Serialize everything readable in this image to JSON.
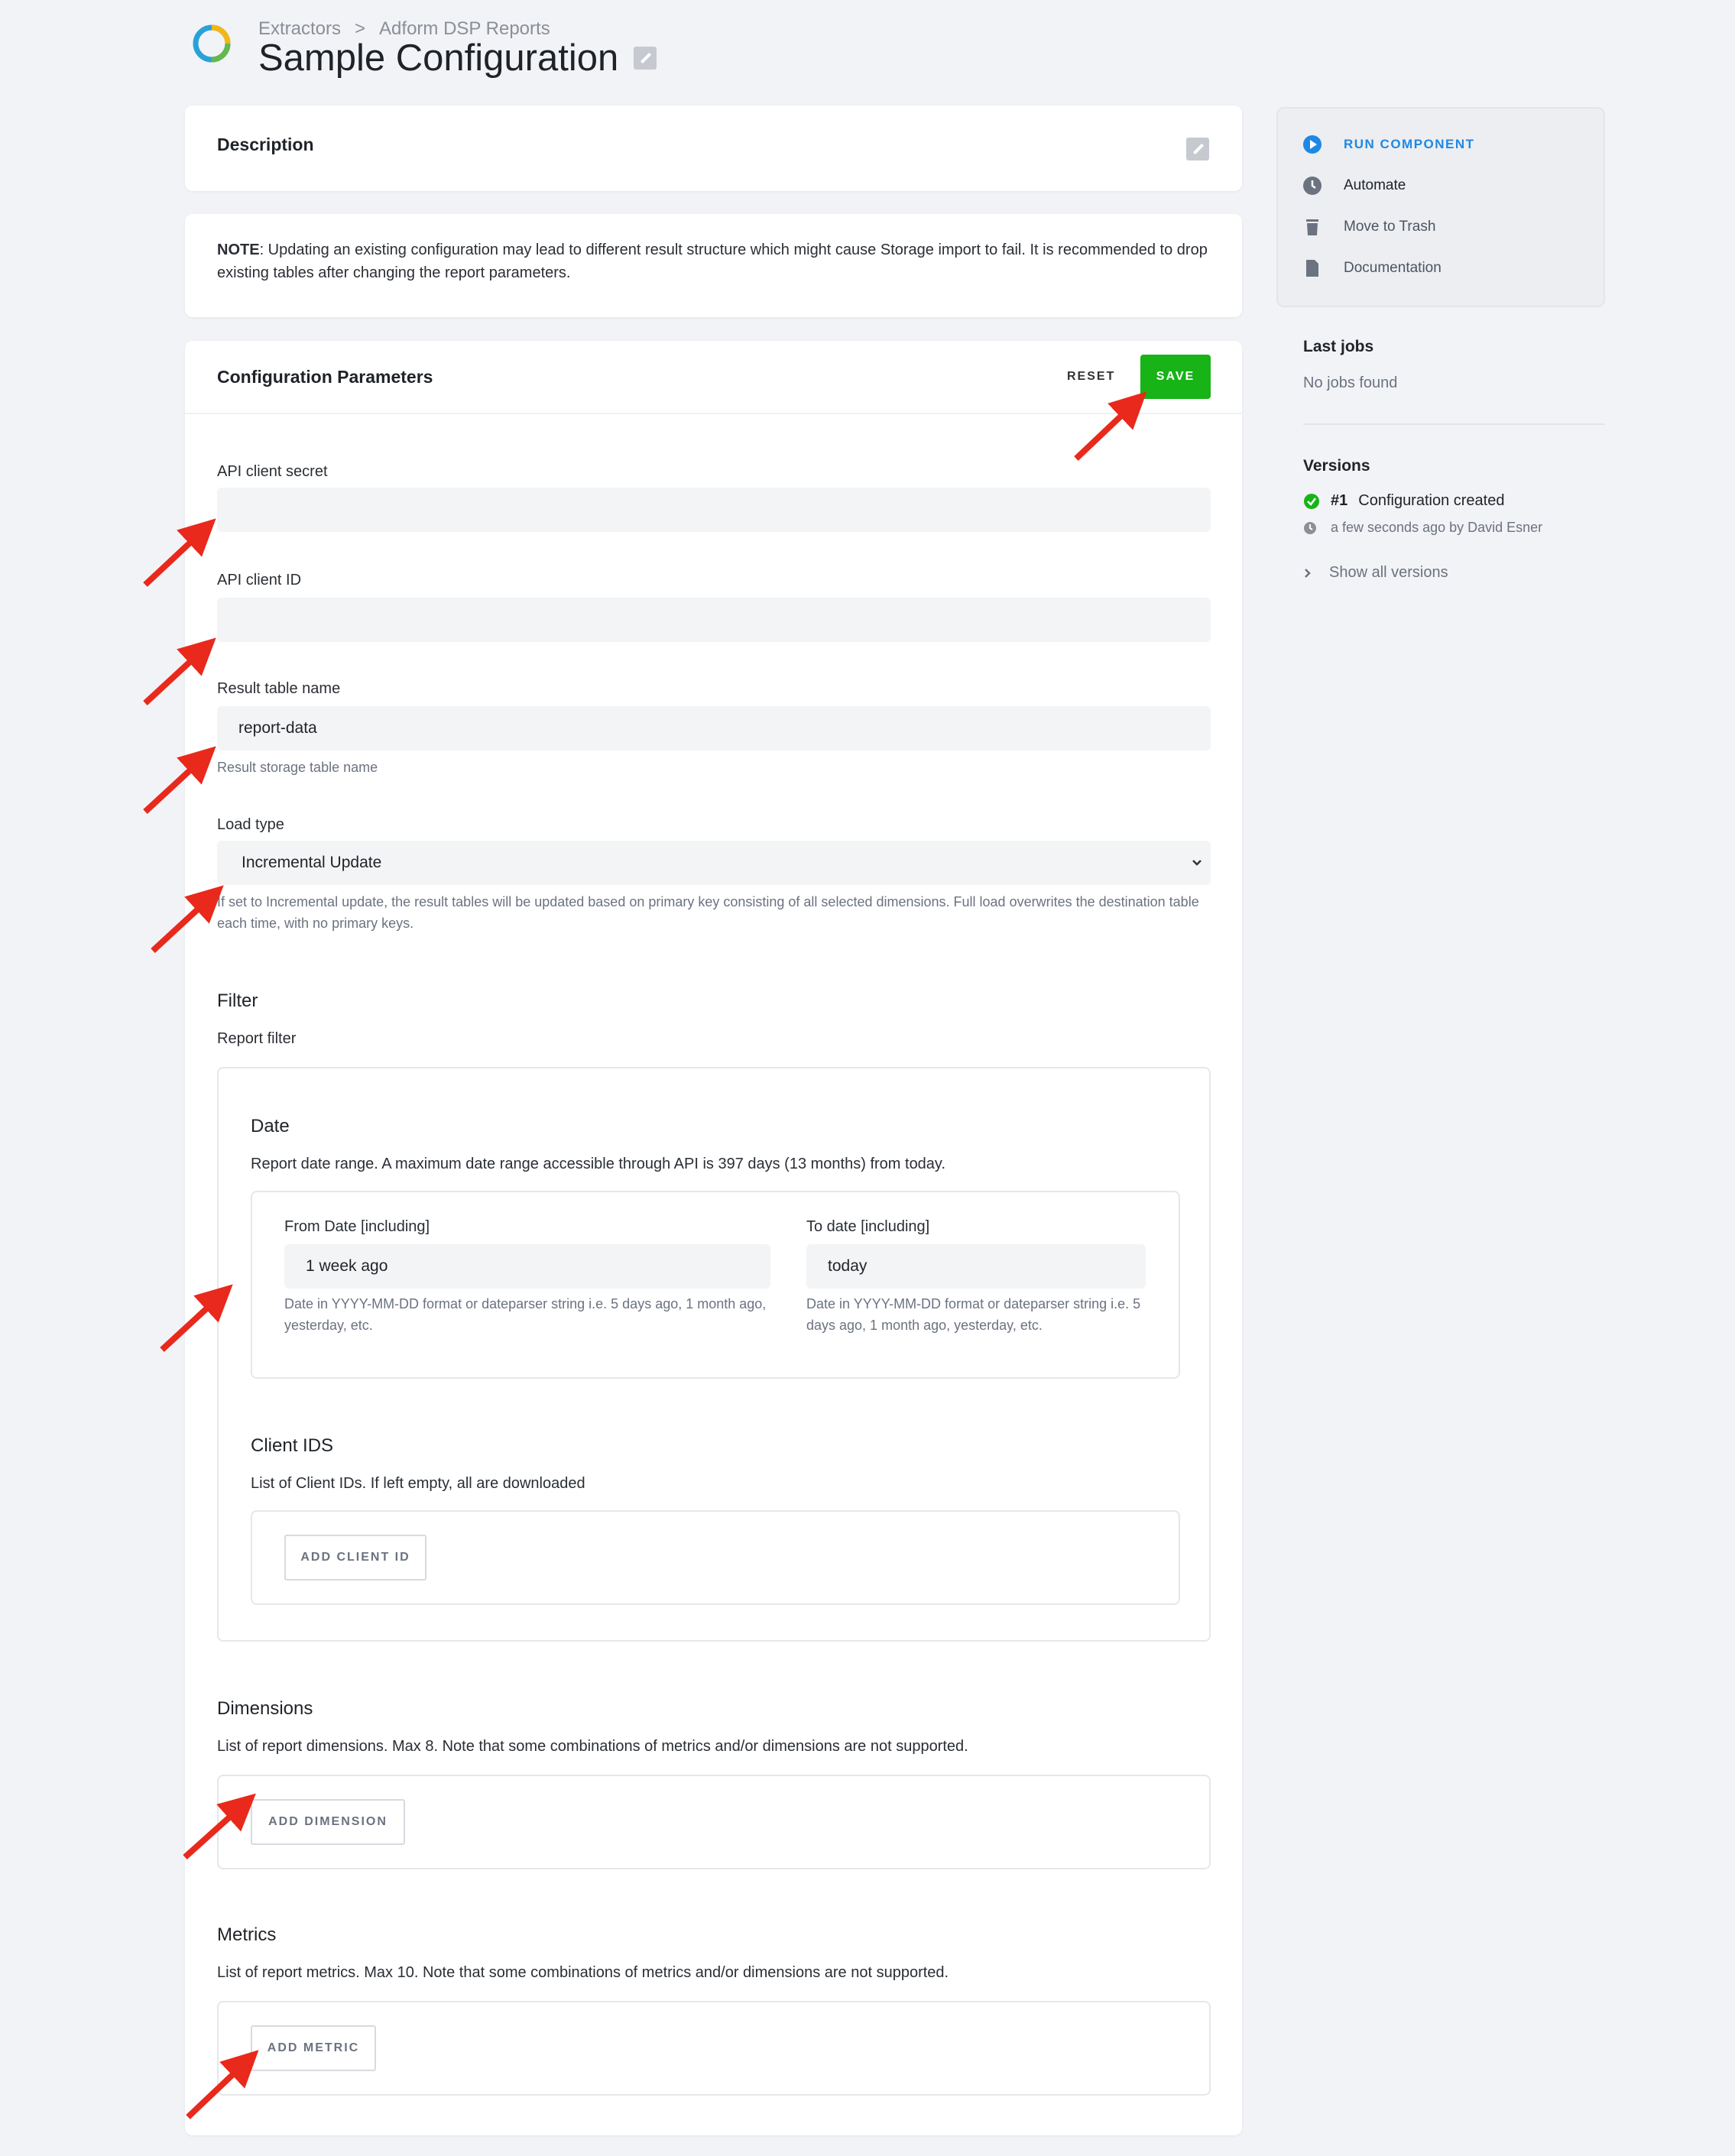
{
  "breadcrumb": {
    "items": [
      "Extractors",
      "Adform DSP Reports"
    ],
    "separator": ">"
  },
  "page": {
    "title": "Sample Configuration"
  },
  "description_card": {
    "heading": "Description"
  },
  "note": {
    "label": "NOTE",
    "text": ": Updating an existing configuration may lead to different result structure which might cause Storage import to fail. It is recommended to drop existing tables after changing the report parameters."
  },
  "config": {
    "heading": "Configuration Parameters",
    "reset_label": "RESET",
    "save_label": "SAVE",
    "fields": {
      "api_secret": {
        "label": "API client secret",
        "value": ""
      },
      "api_id": {
        "label": "API client ID",
        "value": ""
      },
      "table_name": {
        "label": "Result table name",
        "value": "report-data",
        "hint": "Result storage table name"
      },
      "load_type": {
        "label": "Load type",
        "value": "Incremental Update",
        "hint": "If set to Incremental update, the result tables will be updated based on primary key consisting of all selected dimensions. Full load overwrites the destination table each time, with no primary keys."
      }
    },
    "filter": {
      "heading": "Filter",
      "subheading": "Report filter",
      "date": {
        "heading": "Date",
        "desc": "Report date range. A maximum date range accessible through API is 397 days (13 months) from today.",
        "from": {
          "label": "From Date [including]",
          "value": "1 week ago",
          "hint": "Date in YYYY-MM-DD format or dateparser string i.e. 5 days ago, 1 month ago, yesterday, etc."
        },
        "to": {
          "label": "To date [including]",
          "value": "today",
          "hint": "Date in YYYY-MM-DD format or dateparser string i.e. 5 days ago, 1 month ago, yesterday, etc."
        }
      },
      "client_ids": {
        "heading": "Client IDS",
        "desc": "List of Client IDs. If left empty, all are downloaded",
        "button": "ADD CLIENT ID"
      }
    },
    "dimensions": {
      "heading": "Dimensions",
      "desc": "List of report dimensions. Max 8. Note that some combinations of metrics and/or dimensions are not supported.",
      "button": "ADD DIMENSION"
    },
    "metrics": {
      "heading": "Metrics",
      "desc": "List of report metrics. Max 10. Note that some combinations of metrics and/or dimensions are not supported.",
      "button": "ADD METRIC"
    }
  },
  "sidebar": {
    "actions": [
      {
        "label": "RUN COMPONENT",
        "icon": "play-icon"
      },
      {
        "label": "Automate",
        "icon": "clock-icon"
      },
      {
        "label": "Move to Trash",
        "icon": "trash-icon"
      },
      {
        "label": "Documentation",
        "icon": "document-icon"
      }
    ],
    "last_jobs": {
      "heading": "Last jobs",
      "empty": "No jobs found"
    },
    "versions": {
      "heading": "Versions",
      "entry_number": "#1",
      "entry_title": "Configuration created",
      "entry_meta": "a few seconds ago by David Esner",
      "show_all": "Show all versions"
    }
  },
  "colors": {
    "accent": "#1e88e5",
    "save": "#17b317",
    "annotation_arrow": "#e8291c"
  }
}
